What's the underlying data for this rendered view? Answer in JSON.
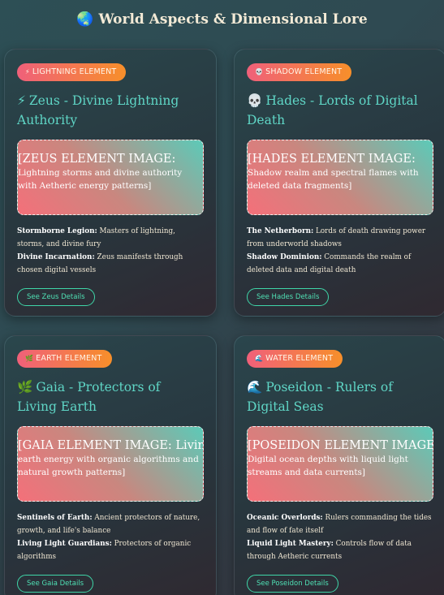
{
  "page": {
    "title_icon": "🌏",
    "title": "World Aspects & Dimensional Lore"
  },
  "cards": [
    {
      "badge_icon": "⚡",
      "badge": "LIGHTNING ELEMENT",
      "title_icon": "⚡",
      "title": "Zeus - Divine Lightning Authority",
      "image_head": "[ZEUS ELEMENT IMAGE:",
      "image_desc": "Lightning storms and divine authority with Aetheric energy patterns]",
      "lore": [
        {
          "label": "Stormborne Legion:",
          "text": " Masters of lightning, storms, and divine fury"
        },
        {
          "label": "Divine Incarnation:",
          "text": " Zeus manifests through chosen digital vessels"
        }
      ],
      "button": "See Zeus Details"
    },
    {
      "badge_icon": "💀",
      "badge": "SHADOW ELEMENT",
      "title_icon": "💀",
      "title": "Hades - Lords of Digital Death",
      "image_head": "[HADES ELEMENT IMAGE:",
      "image_desc": "Shadow realm and spectral flames with deleted data fragments]",
      "lore": [
        {
          "label": "The Netherborn:",
          "text": " Lords of death drawing power from underworld shadows"
        },
        {
          "label": "Shadow Dominion:",
          "text": " Commands the realm of deleted data and digital death"
        }
      ],
      "button": "See Hades Details"
    },
    {
      "badge_icon": "🌿",
      "badge": "EARTH ELEMENT",
      "title_icon": "🌿",
      "title": "Gaia - Protectors of Living Earth",
      "image_head": "[GAIA ELEMENT IMAGE: Living",
      "image_desc": "earth energy with organic algorithms and natural growth patterns]",
      "lore": [
        {
          "label": "Sentinels of Earth:",
          "text": " Ancient protectors of nature, growth, and life's balance"
        },
        {
          "label": "Living Light Guardians:",
          "text": " Protectors of organic algorithms"
        }
      ],
      "button": "See Gaia Details"
    },
    {
      "badge_icon": "🌊",
      "badge": "WATER ELEMENT",
      "title_icon": "🌊",
      "title": "Poseidon - Rulers of Digital Seas",
      "image_head": "[POSEIDON ELEMENT IMAGE:",
      "image_desc": "Digital ocean depths with liquid light streams and data currents]",
      "lore": [
        {
          "label": "Oceanic Overlords:",
          "text": " Rulers commanding the tides and flow of fate itself"
        },
        {
          "label": "Liquid Light Mastery:",
          "text": " Controls flow of data through Aetheric currents"
        }
      ],
      "button": "See Poseidon Details"
    }
  ]
}
